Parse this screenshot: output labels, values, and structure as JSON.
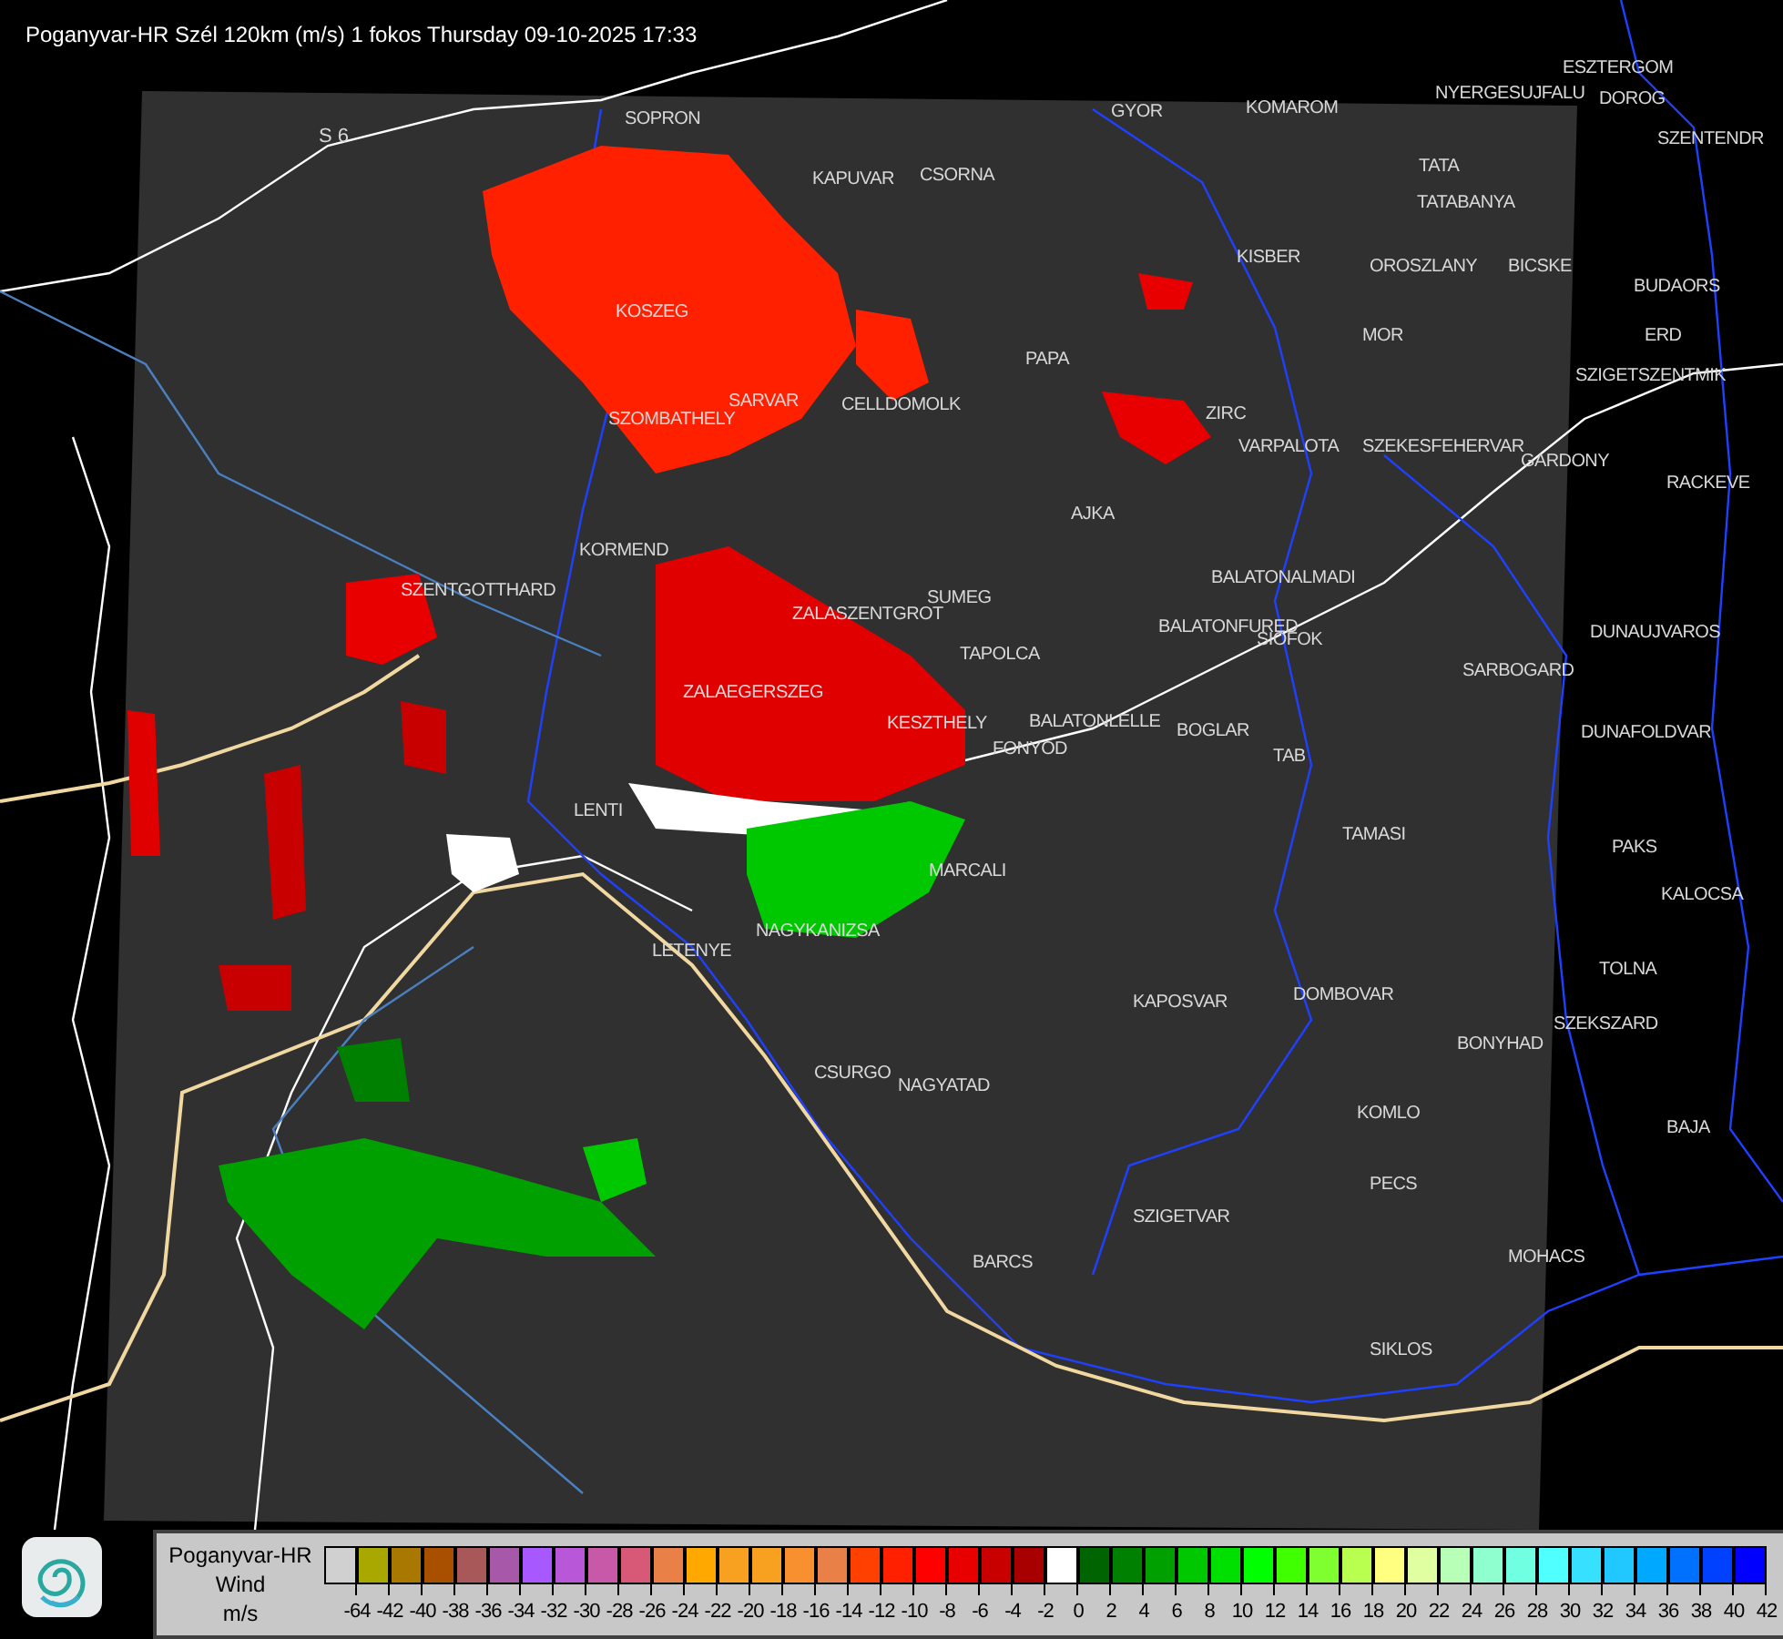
{
  "title": "Poganyvar-HR Szél 120km (m/s) 1 fokos Thursday 09-10-2025 17:33",
  "map": {
    "road_labels": [
      "S 6"
    ],
    "places": [
      "SOPRON",
      "KAPUVAR",
      "CSORNA",
      "GYOR",
      "KOMAROM",
      "ESZTERGOM",
      "NYERGESUJFALU",
      "DOROG",
      "SZENTENDR",
      "TATA",
      "TATABANYA",
      "KISBER",
      "OROSZLANY",
      "BICSKE",
      "BUDAORS",
      "MOR",
      "ERD",
      "SZIGETSZENTMIK",
      "KOSZEG",
      "PAPA",
      "SARVAR",
      "CELLDOMOLK",
      "SZOMBATHELY",
      "ZIRC",
      "VARPALOTA",
      "SZEKESFEHERVAR",
      "GARDONY",
      "RACKEVE",
      "AJKA",
      "KORMEND",
      "SZENTGOTTHARD",
      "BALATONALMADI",
      "SUMEG",
      "ZALASZENTGROT",
      "BALATONFURED",
      "SIOFOK",
      "DUNAUJVAROS",
      "TAPOLCA",
      "SARBOGARD",
      "ZALAEGERSZEG",
      "KESZTHELY",
      "BALATONLELLE",
      "FONYOD",
      "BOGLAR",
      "DUNAFOLDVAR",
      "TAB",
      "LENTI",
      "TAMASI",
      "PAKS",
      "MARCALI",
      "KALOCSA",
      "NAGYKANIZSA",
      "LETENYE",
      "TOLNA",
      "KAPOSVAR",
      "DOMBOVAR",
      "SZEKSZARD",
      "BONYHAD",
      "CSURGO",
      "NAGYATAD",
      "KOMLO",
      "BAJA",
      "PECS",
      "SZIGETVAR",
      "MOHACS",
      "BARCS",
      "SIKLOS"
    ]
  },
  "legend": {
    "title": "Poganyvar-HR",
    "quantity": "Wind",
    "unit": "m/s",
    "items": [
      {
        "color": "#d0d0d0",
        "label": "-64"
      },
      {
        "color": "#a8a800",
        "label": "-42"
      },
      {
        "color": "#a87800",
        "label": "-40"
      },
      {
        "color": "#a85000",
        "label": "-38"
      },
      {
        "color": "#a85858",
        "label": "-36"
      },
      {
        "color": "#a858a8",
        "label": "-34"
      },
      {
        "color": "#a858ff",
        "label": "-32"
      },
      {
        "color": "#b858d8",
        "label": "-30"
      },
      {
        "color": "#c858a8",
        "label": "-28"
      },
      {
        "color": "#d85878",
        "label": "-26"
      },
      {
        "color": "#e88048",
        "label": "-24"
      },
      {
        "color": "#ffa800",
        "label": "-22"
      },
      {
        "color": "#f8a020",
        "label": "-20"
      },
      {
        "color": "#f8a020",
        "label": "-18"
      },
      {
        "color": "#f89030",
        "label": "-16"
      },
      {
        "color": "#e88048",
        "label": "-14"
      },
      {
        "color": "#ff4000",
        "label": "-12"
      },
      {
        "color": "#ff2000",
        "label": "-10"
      },
      {
        "color": "#ff0000",
        "label": "-8"
      },
      {
        "color": "#e80000",
        "label": "-6"
      },
      {
        "color": "#c80000",
        "label": "-4"
      },
      {
        "color": "#a80000",
        "label": "-2"
      },
      {
        "color": "#ffffff",
        "label": "0"
      },
      {
        "color": "#006400",
        "label": "2"
      },
      {
        "color": "#008000",
        "label": "4"
      },
      {
        "color": "#00a000",
        "label": "6"
      },
      {
        "color": "#00c800",
        "label": "8"
      },
      {
        "color": "#00e000",
        "label": "10"
      },
      {
        "color": "#00ff00",
        "label": "12"
      },
      {
        "color": "#40ff00",
        "label": "14"
      },
      {
        "color": "#80ff30",
        "label": "16"
      },
      {
        "color": "#b8ff50",
        "label": "18"
      },
      {
        "color": "#ffff80",
        "label": "20"
      },
      {
        "color": "#e0ffa0",
        "label": "22"
      },
      {
        "color": "#b8ffb8",
        "label": "24"
      },
      {
        "color": "#90ffd0",
        "label": "26"
      },
      {
        "color": "#70ffe0",
        "label": "28"
      },
      {
        "color": "#50ffff",
        "label": "30"
      },
      {
        "color": "#38e0ff",
        "label": "32"
      },
      {
        "color": "#20c8ff",
        "label": "34"
      },
      {
        "color": "#00a8ff",
        "label": "36"
      },
      {
        "color": "#0070ff",
        "label": "38"
      },
      {
        "color": "#0040ff",
        "label": "40"
      },
      {
        "color": "#0000ff",
        "label": "42"
      }
    ]
  }
}
